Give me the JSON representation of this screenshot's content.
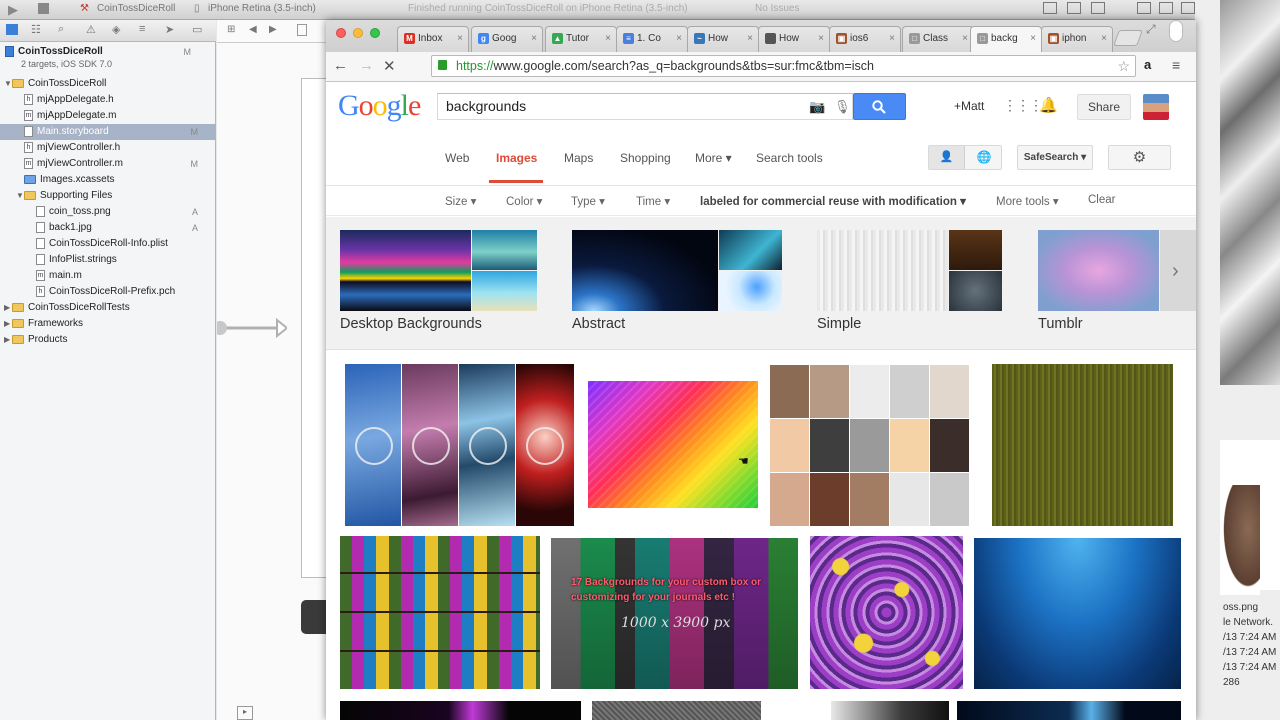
{
  "xcode": {
    "scheme": "CoinTossDiceRoll",
    "device": "iPhone Retina (3.5-inch)",
    "status": "Finished running CoinTossDiceRoll on iPhone Retina (3.5-inch)",
    "issues": "No Issues",
    "project": {
      "name": "CoinTossDiceRoll",
      "subtitle": "2 targets, iOS SDK 7.0",
      "badge": "M"
    },
    "tree": [
      {
        "label": "CoinTossDiceRoll",
        "type": "folder",
        "indent": 0,
        "badge": ""
      },
      {
        "label": "mjAppDelegate.h",
        "type": "h",
        "indent": 1,
        "badge": ""
      },
      {
        "label": "mjAppDelegate.m",
        "type": "m",
        "indent": 1,
        "badge": ""
      },
      {
        "label": "Main.storyboard",
        "type": "sb",
        "indent": 1,
        "badge": "M",
        "selected": true
      },
      {
        "label": "mjViewController.h",
        "type": "h",
        "indent": 1,
        "badge": ""
      },
      {
        "label": "mjViewController.m",
        "type": "m",
        "indent": 1,
        "badge": "M"
      },
      {
        "label": "Images.xcassets",
        "type": "folder",
        "indent": 1,
        "badge": ""
      },
      {
        "label": "Supporting Files",
        "type": "folder",
        "indent": 1,
        "badge": ""
      },
      {
        "label": "coin_toss.png",
        "type": "file",
        "indent": 2,
        "badge": "A"
      },
      {
        "label": "back1.jpg",
        "type": "file",
        "indent": 2,
        "badge": "A"
      },
      {
        "label": "CoinTossDiceRoll-Info.plist",
        "type": "file",
        "indent": 2,
        "badge": ""
      },
      {
        "label": "InfoPlist.strings",
        "type": "file",
        "indent": 2,
        "badge": ""
      },
      {
        "label": "main.m",
        "type": "m",
        "indent": 2,
        "badge": ""
      },
      {
        "label": "CoinTossDiceRoll-Prefix.pch",
        "type": "h",
        "indent": 2,
        "badge": ""
      },
      {
        "label": "CoinTossDiceRollTests",
        "type": "folder",
        "indent": 0,
        "badge": ""
      },
      {
        "label": "Frameworks",
        "type": "folder",
        "indent": 0,
        "badge": ""
      },
      {
        "label": "Products",
        "type": "folder",
        "indent": 0,
        "badge": ""
      }
    ],
    "right_panel": [
      "oss.png",
      "le Network.",
      "/13 7:24 AM",
      "/13 7:24 AM",
      "/13 7:24 AM",
      "286"
    ]
  },
  "chrome": {
    "tabs": [
      {
        "label": "Inbox",
        "icon": "gmail-icon",
        "color": "#d93025",
        "glyph": "M"
      },
      {
        "label": "Goog",
        "icon": "google-icon",
        "color": "#4285f4",
        "glyph": "g"
      },
      {
        "label": "Tutor",
        "icon": "drive-icon",
        "color": "#34a853",
        "glyph": "▲"
      },
      {
        "label": "1. Co",
        "icon": "docs-icon",
        "color": "#4a7fe0",
        "glyph": "≡"
      },
      {
        "label": "How",
        "icon": "site-icon",
        "color": "#3a77b8",
        "glyph": "~"
      },
      {
        "label": "How",
        "icon": "apple-icon",
        "color": "#555555",
        "glyph": ""
      },
      {
        "label": "ios6",
        "icon": "forum-icon",
        "color": "#a0522d",
        "glyph": "▣"
      },
      {
        "label": "Class",
        "icon": "page-icon",
        "color": "#999999",
        "glyph": "□"
      },
      {
        "label": "backg",
        "icon": "page-icon",
        "color": "#999999",
        "glyph": "□"
      },
      {
        "label": "iphon",
        "icon": "forum-icon",
        "color": "#a0522d",
        "glyph": "▣"
      }
    ],
    "active_tab": 8,
    "url_https": "https://",
    "url_rest": "www.google.com/search?as_q=backgrounds&tbs=sur:fmc&tbm=isch"
  },
  "google": {
    "query": "backgrounds",
    "user": "+Matt",
    "share": "Share",
    "nav": [
      "Web",
      "Images",
      "Maps",
      "Shopping",
      "More ▾",
      "Search tools"
    ],
    "safesearch": "SafeSearch ▾",
    "tools": [
      "Size ▾",
      "Color ▾",
      "Type ▾",
      "Time ▾",
      "labeled for commercial reuse with modification ▾",
      "More tools ▾",
      "Clear"
    ],
    "categories": [
      "Desktop Backgrounds",
      "Abstract",
      "Simple",
      "Tumblr"
    ],
    "thumb_caption": "17 Backgrounds for your custom box or customizing for your journals etc !",
    "thumb_dims": "1000 x 3900 px"
  }
}
